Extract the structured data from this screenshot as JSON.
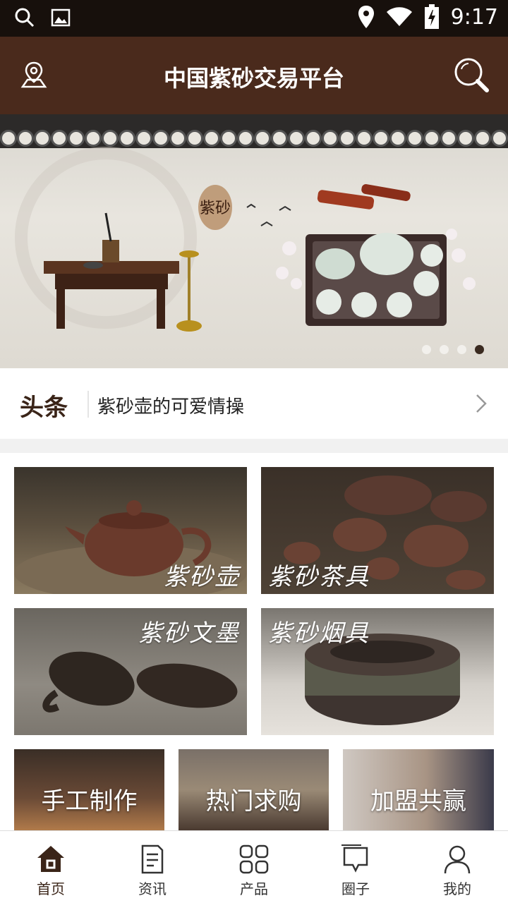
{
  "status_bar": {
    "time": "9:17"
  },
  "app_bar": {
    "title": "中国紫砂交易平台"
  },
  "banner": {
    "calligraphy": "紫砂",
    "dot_count": 4,
    "active_dot": 3
  },
  "headline": {
    "tag": "头条",
    "text": "紫砂壶的可爱情操"
  },
  "categories": [
    {
      "label": "紫砂壶"
    },
    {
      "label": "紫砂茶具"
    },
    {
      "label": "紫砂文墨"
    },
    {
      "label": "紫砂烟具"
    }
  ],
  "features": [
    {
      "label": "手工制作"
    },
    {
      "label": "热门求购"
    },
    {
      "label": "加盟共赢"
    }
  ],
  "bottom_nav": [
    {
      "label": "首页",
      "icon": "home-icon",
      "active": true
    },
    {
      "label": "资讯",
      "icon": "news-icon",
      "active": false
    },
    {
      "label": "产品",
      "icon": "products-icon",
      "active": false
    },
    {
      "label": "圈子",
      "icon": "circle-icon",
      "active": false
    },
    {
      "label": "我的",
      "icon": "profile-icon",
      "active": false
    }
  ],
  "colors": {
    "brand_brown": "#4a2a1c",
    "active_nav": "#3a2418"
  }
}
